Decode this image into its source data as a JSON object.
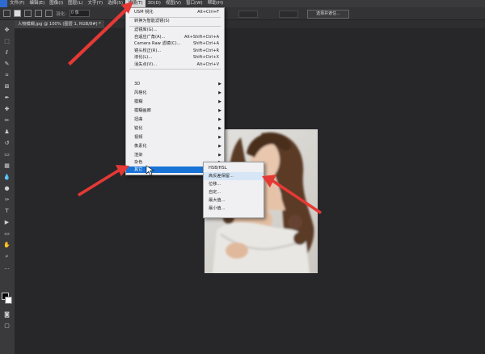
{
  "menubar": {
    "items": [
      {
        "label": "文件(F)"
      },
      {
        "label": "编辑(E)"
      },
      {
        "label": "图像(I)"
      },
      {
        "label": "图层(L)"
      },
      {
        "label": "文字(Y)"
      },
      {
        "label": "选择(S)"
      },
      {
        "label": "滤镜(T)"
      },
      {
        "label": "3D(D)"
      },
      {
        "label": "视图(V)"
      },
      {
        "label": "窗口(W)"
      },
      {
        "label": "帮助(H)"
      }
    ],
    "active_index": 6
  },
  "options_bar": {
    "feather_label": "羽化:",
    "feather_value": "0 像",
    "select_button": "选择并遮住..."
  },
  "document_tab": {
    "label": "人物模糊.jpg @ 100% (图层 1, RGB/8#) *"
  },
  "filter_menu": {
    "items": [
      {
        "label": "USM 锐化",
        "shortcut": "Alt+Ctrl+F"
      },
      {
        "label": "转换为智能滤镜(S)"
      },
      {
        "label": "滤镜库(G)..."
      },
      {
        "label": "自适应广角(A)...",
        "shortcut": "Alt+Shift+Ctrl+A"
      },
      {
        "label": "Camera Raw 滤镜(C)...",
        "shortcut": "Shift+Ctrl+A"
      },
      {
        "label": "镜头校正(R)...",
        "shortcut": "Shift+Ctrl+R"
      },
      {
        "label": "液化(L)...",
        "shortcut": "Shift+Ctrl+X"
      },
      {
        "label": "消失点(V)...",
        "shortcut": "Alt+Ctrl+V"
      },
      {
        "label": "3D"
      },
      {
        "label": "风格化"
      },
      {
        "label": "模糊"
      },
      {
        "label": "模糊画廊"
      },
      {
        "label": "扭曲"
      },
      {
        "label": "锐化"
      },
      {
        "label": "视频"
      },
      {
        "label": "像素化"
      },
      {
        "label": "渲染"
      },
      {
        "label": "杂色"
      },
      {
        "label": "其它"
      }
    ]
  },
  "other_submenu": {
    "items": [
      {
        "label": "HSB/HSL"
      },
      {
        "label": "高反差保留..."
      },
      {
        "label": "位移..."
      },
      {
        "label": "自定..."
      },
      {
        "label": "最大值..."
      },
      {
        "label": "最小值..."
      }
    ]
  },
  "colors": {
    "accent": "#1a73d7",
    "arrow": "#e53935"
  }
}
